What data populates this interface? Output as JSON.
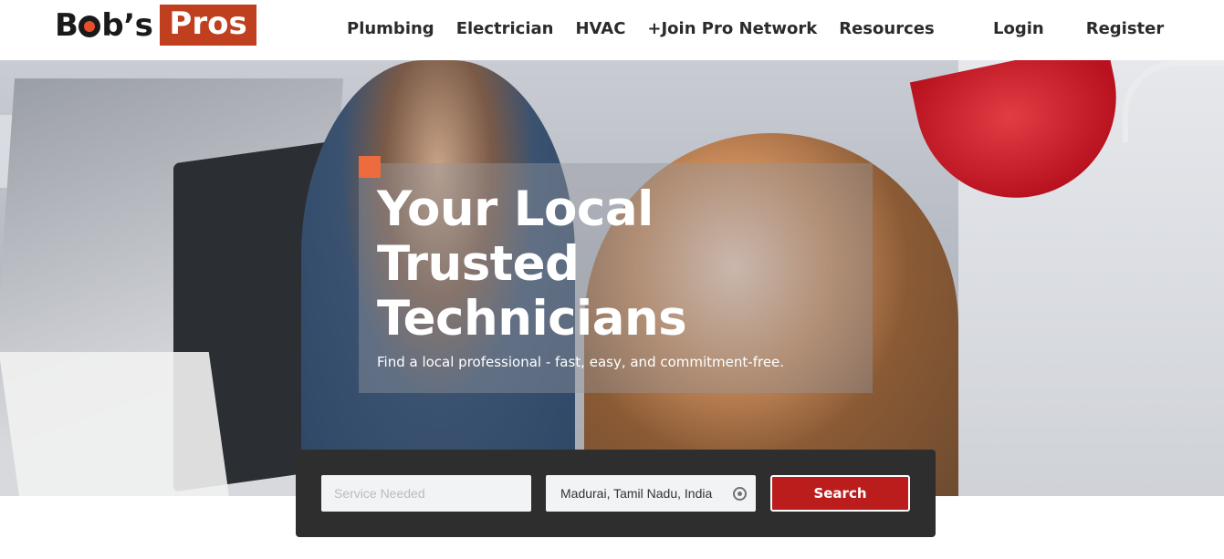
{
  "brand": {
    "name_part1": "B",
    "name_part2": "b’s",
    "name_highlight": "Pros",
    "accent_color": "#bf3f1f"
  },
  "nav": {
    "main": [
      "Plumbing",
      "Electrician",
      "HVAC",
      "+Join Pro Network",
      "Resources"
    ],
    "login": "Login",
    "register": "Register"
  },
  "hero": {
    "title": "Your Local Trusted Technicians",
    "subtitle": "Find a local professional - fast, easy, and commitment-free.",
    "accent_color": "#ec6b3f"
  },
  "search": {
    "service_placeholder": "Service Needed",
    "service_value": "",
    "location_value": "Madurai, Tamil Nadu, India",
    "location_icon": "locate-icon",
    "button_label": "Search",
    "button_color": "#bb1c1c"
  }
}
